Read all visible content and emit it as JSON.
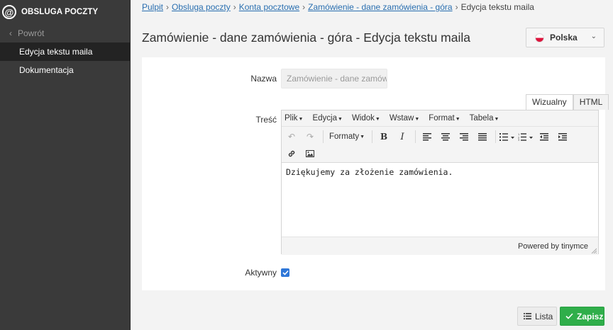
{
  "sidebar": {
    "logo_glyph": "@",
    "title": "OBSLUGA POCZTY",
    "back_label": "Powrót",
    "items": [
      {
        "label": "Edycja tekstu maila",
        "active": true
      },
      {
        "label": "Dokumentacja",
        "active": false
      }
    ]
  },
  "breadcrumb": {
    "links": [
      "Pulpit",
      "Obsluga poczty",
      "Konta pocztowe",
      "Zamówienie - dane zamówienia - góra"
    ],
    "current": "Edycja tekstu maila",
    "separator": "›"
  },
  "page": {
    "title": "Zamówienie - dane zamówienia - góra - Edycja tekstu maila"
  },
  "language": {
    "selected": "Polska",
    "flag_icon": "poland-flag-icon"
  },
  "form": {
    "name_label": "Nazwa",
    "name_value": "Zamówienie - dane zamówi",
    "content_label": "Treść",
    "active_label": "Aktywny",
    "active_checked": true
  },
  "editor": {
    "tabs": [
      "Wizualny",
      "HTML"
    ],
    "active_tab": "Wizualny",
    "menu": [
      "Plik",
      "Edycja",
      "Widok",
      "Wstaw",
      "Format",
      "Tabela"
    ],
    "formats_label": "Formaty",
    "content": "Dziękujemy za złożenie zamówienia.",
    "powered_by": "Powered by tinymce"
  },
  "actions": {
    "list_label": "Lista",
    "save_label": "Zapisz"
  },
  "colors": {
    "sidebar_bg": "#3a3a3a",
    "link": "#2a6fb0",
    "save_button": "#2fae4a",
    "checkbox": "#2f77d8"
  }
}
